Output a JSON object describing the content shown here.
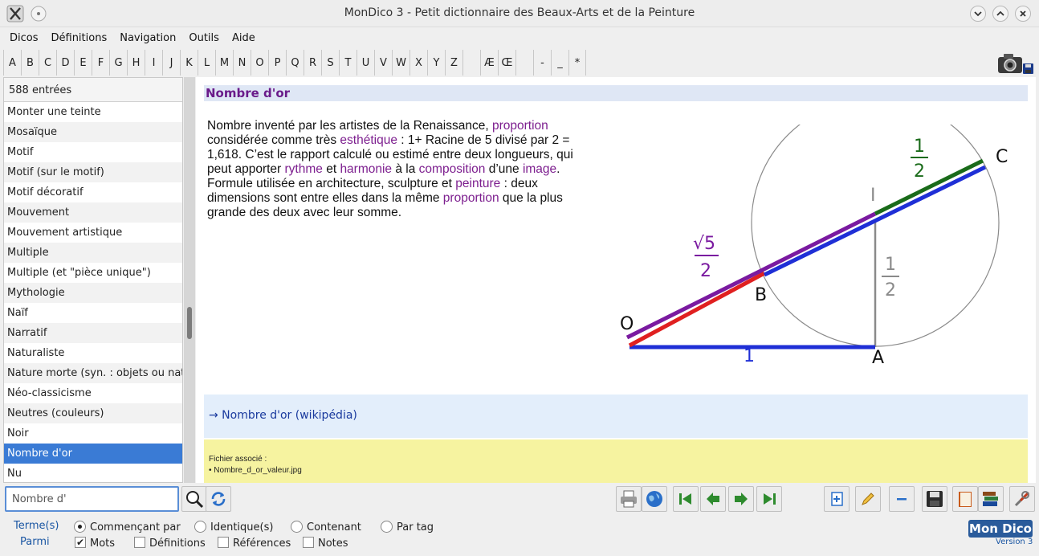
{
  "window": {
    "title": "MonDico 3 - Petit dictionnaire des Beaux-Arts et de la Peinture"
  },
  "menu": [
    "Dicos",
    "Définitions",
    "Navigation",
    "Outils",
    "Aide"
  ],
  "letters": [
    "A",
    "B",
    "C",
    "D",
    "E",
    "F",
    "G",
    "H",
    "I",
    "J",
    "K",
    "L",
    "M",
    "N",
    "O",
    "P",
    "Q",
    "R",
    "S",
    "T",
    "U",
    "V",
    "W",
    "X",
    "Y",
    "Z",
    "",
    "Æ",
    "Œ",
    "",
    "-",
    "_",
    "*"
  ],
  "list": {
    "count": "588 entrées",
    "items": [
      "Monter une teinte",
      "Mosaïque",
      "Motif",
      "Motif (sur le motif)",
      "Motif décoratif",
      "Mouvement",
      "Mouvement artistique",
      "Multiple",
      "Multiple (et \"pièce unique\")",
      "Mythologie",
      "Naïf",
      "Narratif",
      "Naturaliste",
      "Nature morte (syn. : objets ou natures",
      "Néo-classicisme",
      "Neutres (couleurs)",
      "Noir",
      "Nombre d'or",
      "Nu"
    ],
    "selected_index": 17
  },
  "entry": {
    "title": "Nombre d'or",
    "definition": [
      {
        "t": "Nombre inventé par les artistes de la Renaissance, "
      },
      {
        "t": "proportion",
        "link": true
      },
      {
        "t": " considérée comme très "
      },
      {
        "t": "esthétique",
        "link": true
      },
      {
        "t": " : 1+ Racine de 5 divisé par 2 = 1,618. C’est le rapport calculé ou estimé entre deux longueurs, qui peut apporter "
      },
      {
        "t": "rythme",
        "link": true
      },
      {
        "t": " et "
      },
      {
        "t": "harmonie",
        "link": true
      },
      {
        "t": " à la "
      },
      {
        "t": "composition",
        "link": true
      },
      {
        "t": " d’une "
      },
      {
        "t": "image",
        "link": true
      },
      {
        "t": ". Formule utilisée en architecture, sculpture et "
      },
      {
        "t": "peinture",
        "link": true
      },
      {
        "t": " : deux dimensions sont entre elles dans la même "
      },
      {
        "t": "proportion",
        "link": true
      },
      {
        "t": " que la plus grande des deux avec leur somme."
      }
    ],
    "figure": {
      "label_O": "O",
      "label_A": "A",
      "label_B": "B",
      "label_C": "C",
      "label_I": "I",
      "frac_sqrt5_num": "√5",
      "frac_sqrt5_den": "2",
      "frac_half_num": "1",
      "frac_half_den": "2",
      "frac_gray_num": "1",
      "frac_gray_den": "2",
      "label_one": "1",
      "colors": {
        "blue": "#1f2fd6",
        "red": "#e02020",
        "purple": "#7a1aa0",
        "green": "#1a6b1a",
        "gray": "#8a8a8a"
      }
    },
    "wiki_link": "→ Nombre d'or (wikipédia)",
    "file_label": "Fichier associé :",
    "file_name": "• Nombre_d_or_valeur.jpg"
  },
  "search": {
    "value": "Nombre d'"
  },
  "options": {
    "terms_label": "Terme(s)",
    "among_label": "Parmi",
    "radios": [
      {
        "label": "Commençant par",
        "checked": true
      },
      {
        "label": "Identique(s)",
        "checked": false
      },
      {
        "label": "Contenant",
        "checked": false
      },
      {
        "label": "Par tag",
        "checked": false
      }
    ],
    "checks": [
      {
        "label": "Mots",
        "checked": true
      },
      {
        "label": "Définitions",
        "checked": false
      },
      {
        "label": "Références",
        "checked": false
      },
      {
        "label": "Notes",
        "checked": false
      }
    ]
  },
  "brand": {
    "logo": "Mon Dico",
    "version": "Version 3"
  }
}
